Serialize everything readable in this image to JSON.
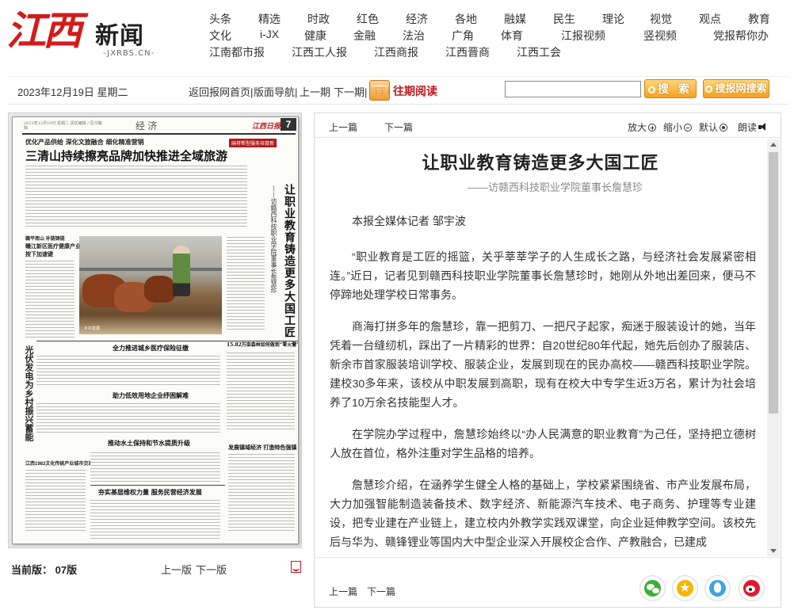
{
  "logo": {
    "brand": "江西",
    "news": "新闻",
    "url": "-JXRBS.CN-"
  },
  "nav": {
    "row1": [
      "头条",
      "精选",
      "时政",
      "红色",
      "经济",
      "各地",
      "融媒",
      "民生",
      "理论",
      "视觉",
      "观点",
      "教育"
    ],
    "row2": [
      "文化",
      "i-JX",
      "健康",
      "金融",
      "法治",
      "广角",
      "体育",
      "江报视频",
      "竖视频",
      "党报帮你办"
    ],
    "row3": [
      "江南都市报",
      "江西工人报",
      "江西商报",
      "江西晋商",
      "江西工会"
    ]
  },
  "toolbar": {
    "date": "2023年12月19日 星期二",
    "home": "返回报网首页|",
    "page_nav": "版面导航|",
    "prev": "上一期",
    "next": "下一期|",
    "archive": "往期阅读",
    "search_value": "",
    "search_btn": "搜 索",
    "site_search_btn": "搜报网搜索"
  },
  "paper": {
    "date_lines": "2023年12月19日 星期二  责任编辑 / 见习编辑",
    "section": "经 济",
    "logo": "江西日报",
    "page_no": "7",
    "kicker": "优化产品供给  深化文旅融合  细化精准营销",
    "badge": "麻将帮型服务培育新",
    "headline": "三清山持续擦亮品牌加快推进全域旅游",
    "vert_title": "让职业教育铸造更多大国工匠",
    "vert_sub": "——访赣西科技职业学院董事长詹慧珍",
    "vert_left": "光伏发电为乡村振兴蓄能",
    "small1": "赣平南山  补链铸链",
    "small2": "赣江新区医疗健康产业",
    "small3": "按下加速键",
    "photo_caption": "乡村发展",
    "head_a": "全力推进城乡医疗保险征缴",
    "head_b": "15.82万亩森林如何做到“零火警”",
    "head_c": "助力低效用地企业纾困解难",
    "head_d": "推动水土保持和节水提质升级",
    "head_e": "发展镇域经济  打造特色强镇",
    "head_f": "江西1983文化传统产业城市交汇",
    "head_g": "夯实基层维权力量  服务民营经济发展"
  },
  "left_bottom": {
    "current": "当前版： 07版",
    "prev": "上一版",
    "next": "下一版"
  },
  "reader": {
    "prev": "上一篇",
    "next": "下一篇",
    "zoom_in": "放大",
    "zoom_out": "缩小",
    "default": "默认",
    "read": "朗读"
  },
  "article": {
    "title": "让职业教育铸造更多大国工匠",
    "subtitle": "——访赣西科技职业学院董事长詹慧珍",
    "author": "本报全媒体记者 邹宇波",
    "paragraphs": [
      "“职业教育是工匠的摇篮，关乎莘莘学子的人生成长之路，与经济社会发展紧密相连。”近日，记者见到赣西科技职业学院董事长詹慧珍时，她刚从外地出差回来，便马不停蹄地处理学校日常事务。",
      "商海打拼多年的詹慧珍，靠一把剪刀、一把尺子起家，痴迷于服装设计的她，当年凭着一台缝纫机，踩出了一片精彩的世界：自20世纪80年代起，她先后创办了服装店、新余市首家服装培训学校、服装企业，发展到现在的民办高校——赣西科技职业学院。建校30多年来，该校从中职发展到高职，现有在校大中专学生近3万名，累计为社会培养了10万余名技能型人才。",
      "在学院办学过程中，詹慧珍始终以“办人民满意的职业教育”为己任，坚持把立德树人放在首位，格外注重对学生品格的培养。",
      "詹慧珍介绍，在涵养学生健全人格的基础上，学校紧紧围绕省、市产业发展布局，大力加强智能制造装备技术、数字经济、新能源汽车技术、电子商务、护理等专业建设，把专业建在产业链上，建立校内外教学实践双课堂，向企业延伸教学空间。该校先后与华为、赣锋锂业等国内大中型企业深入开展校企合作、产教融合，已建成"
    ]
  },
  "share": {
    "icons": [
      "wechat-icon",
      "qzone-icon",
      "qq-icon",
      "weibo-icon"
    ]
  }
}
